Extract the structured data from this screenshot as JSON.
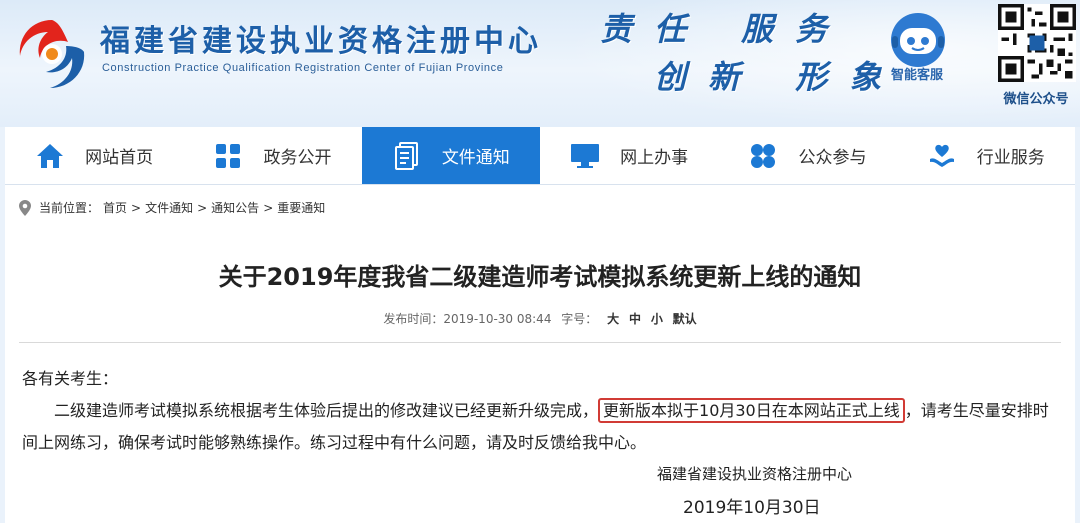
{
  "header": {
    "site_title": "福建省建设执业资格注册中心",
    "site_subtitle": "Construction Practice Qualification Registration Center of Fujian Province",
    "slogan_line1": "责任 服务",
    "slogan_line2": "创新 形象",
    "robot_label": "智能客服",
    "qr_label": "微信公众号",
    "brand_color": "#1d5fa8"
  },
  "nav": {
    "active_color": "#1c79d4",
    "items": [
      {
        "label": "网站首页",
        "icon": "home-icon"
      },
      {
        "label": "政务公开",
        "icon": "grid-icon"
      },
      {
        "label": "文件通知",
        "icon": "document-icon"
      },
      {
        "label": "网上办事",
        "icon": "monitor-icon"
      },
      {
        "label": "公众参与",
        "icon": "circles-icon"
      },
      {
        "label": "行业服务",
        "icon": "heart-hand-icon"
      }
    ],
    "active_index": 2
  },
  "breadcrumb": {
    "prefix": "当前位置：",
    "items": [
      "首页",
      "文件通知",
      "通知公告",
      "重要通知"
    ],
    "separator": ">"
  },
  "article": {
    "title": "关于2019年度我省二级建造师考试模拟系统更新上线的通知",
    "meta_time_label": "发布时间：2019-10-30 08:44",
    "meta_font_label": "字号：",
    "font_sizes": [
      "大",
      "中",
      "小",
      "默认"
    ],
    "greeting": "各有关考生：",
    "para_part1": "二级建造师考试模拟系统根据考生体验后提出的修改建议已经更新升级完成，",
    "para_highlight": "更新版本拟于10月30日在本网站正式上线",
    "para_part2": "，请考生尽量安排时间上网练习，确保考试时能够熟练操作。练习过程中有什么问题，请及时反馈给我中心。",
    "highlight_color": "#d13b35",
    "sign_org": "福建省建设执业资格注册中心",
    "sign_date": "2019年10月30日"
  }
}
